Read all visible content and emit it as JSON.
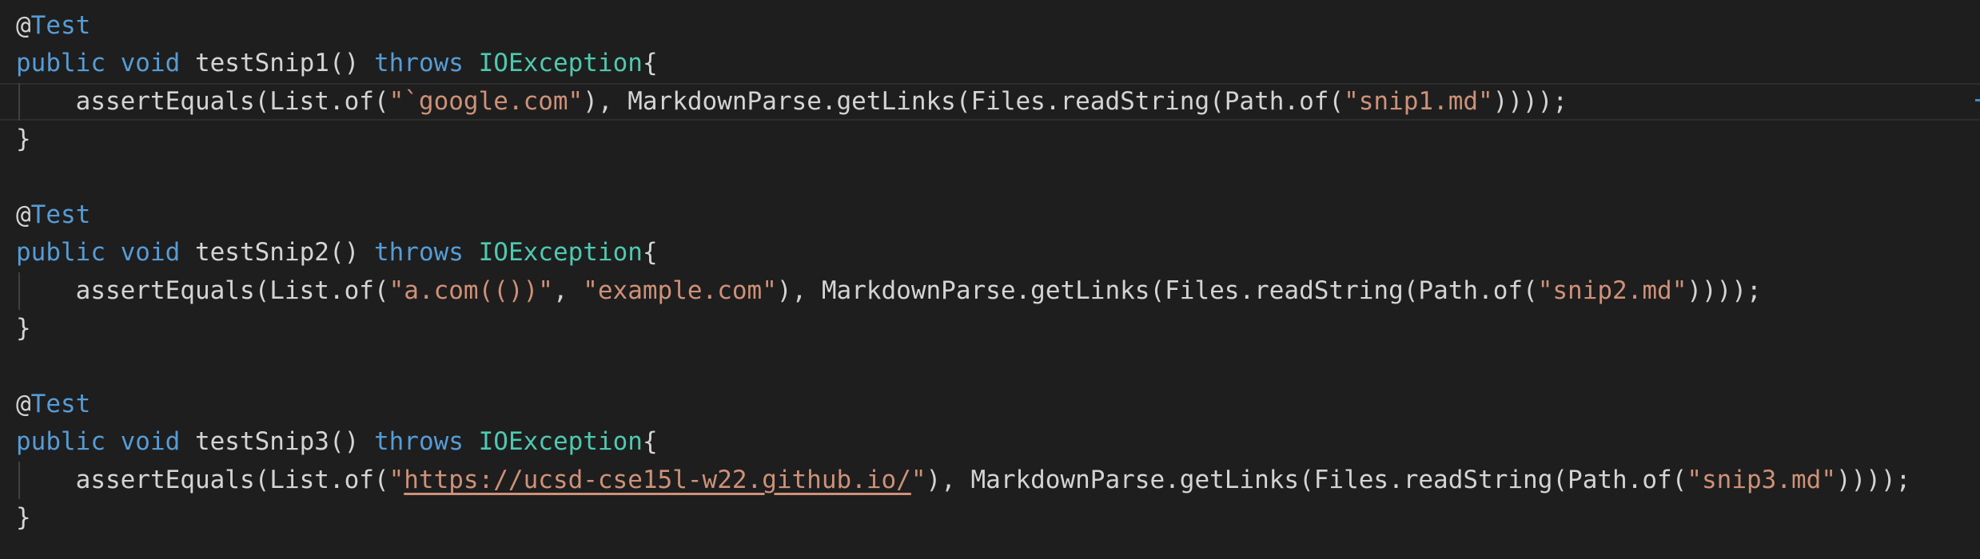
{
  "theme": {
    "background": "#1e1e1e",
    "keyword_color": "#569cd6",
    "string_color": "#ce9178",
    "text_color": "#d4d4d4"
  },
  "tests": [
    {
      "annotation": "@Test",
      "modifiers": "public void",
      "method_name": "testSnip1()",
      "throws_kw": "throws",
      "exception": "IOException",
      "open_brace": "{",
      "assert_prefix": "assertEquals(List.of(",
      "expected_strings": [
        "\"`google.com\""
      ],
      "separators": [],
      "middle": "), MarkdownParse.getLinks(Files.readString(Path.of(",
      "file_arg": "\"snip1.md\"",
      "tail": "))));",
      "close_brace": "}"
    },
    {
      "annotation": "@Test",
      "modifiers": "public void",
      "method_name": "testSnip2()",
      "throws_kw": "throws",
      "exception": "IOException",
      "open_brace": "{",
      "assert_prefix": "assertEquals(List.of(",
      "expected_strings": [
        "\"a.com(())\"",
        "\"example.com\""
      ],
      "separators": [
        ", "
      ],
      "middle": "), MarkdownParse.getLinks(Files.readString(Path.of(",
      "file_arg": "\"snip2.md\"",
      "tail": "))));",
      "close_brace": "}"
    },
    {
      "annotation": "@Test",
      "modifiers": "public void",
      "method_name": "testSnip3()",
      "throws_kw": "throws",
      "exception": "IOException",
      "open_brace": "{",
      "assert_prefix": "assertEquals(List.of(",
      "expected_strings": [
        "\"https://ucsd-cse15l-w22.github.io/\""
      ],
      "separators": [],
      "middle": "), MarkdownParse.getLinks(Files.readString(Path.of(",
      "file_arg": "\"snip3.md\"",
      "tail": "))));",
      "close_brace": "}"
    }
  ]
}
